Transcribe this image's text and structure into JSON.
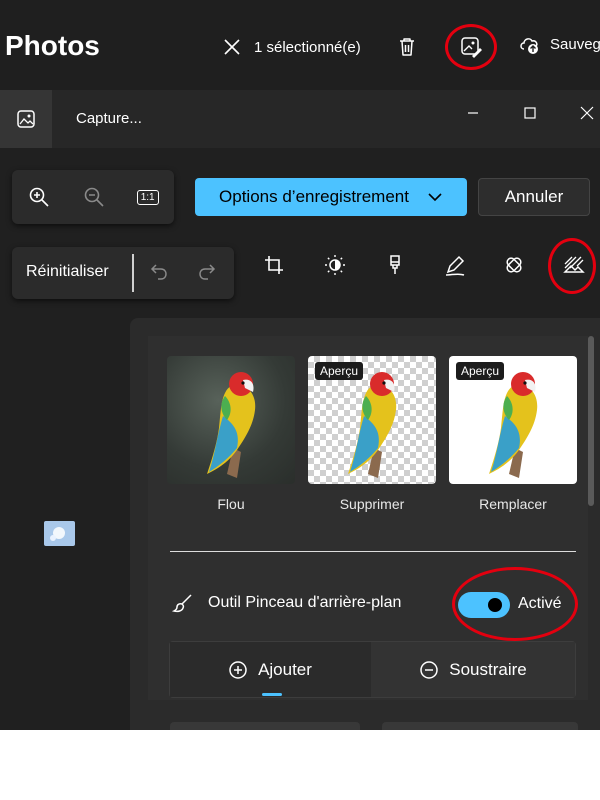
{
  "header": {
    "app_title": "Photos",
    "selection_text": "1 sélectionné(e)",
    "save_text": "Sauvega"
  },
  "tab": {
    "title": "Capture..."
  },
  "toolbar": {
    "save_options_label": "Options d’enregistrement",
    "cancel_label": "Annuler",
    "reset_label": "Réinitialiser",
    "zoom_reset_label": "1:1"
  },
  "background_options": [
    {
      "label": "Flou",
      "badge": ""
    },
    {
      "label": "Supprimer",
      "badge": "Aperçu"
    },
    {
      "label": "Remplacer",
      "badge": "Aperçu"
    }
  ],
  "brush_tool": {
    "label": "Outil Pinceau d'arrière-plan",
    "toggle_state": "Activé",
    "enabled": true
  },
  "modes": {
    "add_label": "Ajouter",
    "subtract_label": "Soustraire",
    "selected": "add"
  },
  "colors": {
    "accent": "#4cc2ff",
    "annotation_ring": "#e3000f"
  },
  "icons": {
    "close": "close-icon",
    "delete": "trash-icon",
    "edit": "edit-image-icon",
    "cloud": "cloud-upload-icon",
    "crop": "crop-icon",
    "brightness": "brightness-icon",
    "filter": "brush-icon",
    "markup": "pen-icon",
    "retouch": "retouch-icon",
    "background": "background-icon"
  }
}
